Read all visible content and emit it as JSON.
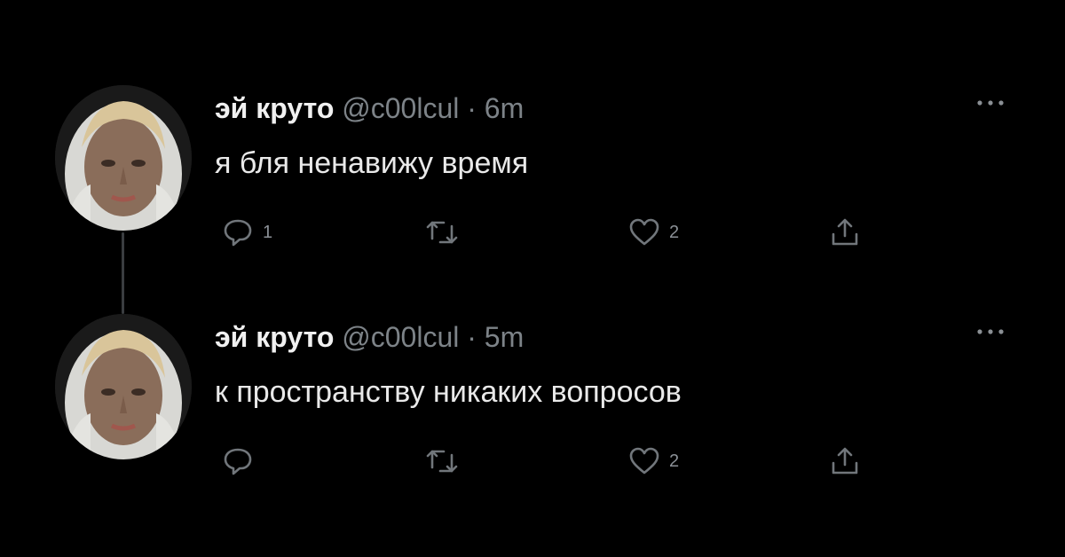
{
  "tweets": [
    {
      "name": "эй круто",
      "handle": "@c00lcul",
      "separator": "·",
      "time": "6m",
      "text": "я бля ненавижу время",
      "reply_count": "1",
      "like_count": "2"
    },
    {
      "name": "эй круто",
      "handle": "@c00lcul",
      "separator": "·",
      "time": "5m",
      "text": "к пространству никаких вопросов",
      "reply_count": "",
      "like_count": "2"
    }
  ],
  "icons": {
    "reply": "comment-bubble-icon",
    "retweet": "retweet-icon",
    "like": "heart-icon",
    "share": "share-upload-icon",
    "more": "more-dots-icon"
  },
  "colors": {
    "background": "#000000",
    "text": "#e7e9ea",
    "muted": "#71767b"
  }
}
